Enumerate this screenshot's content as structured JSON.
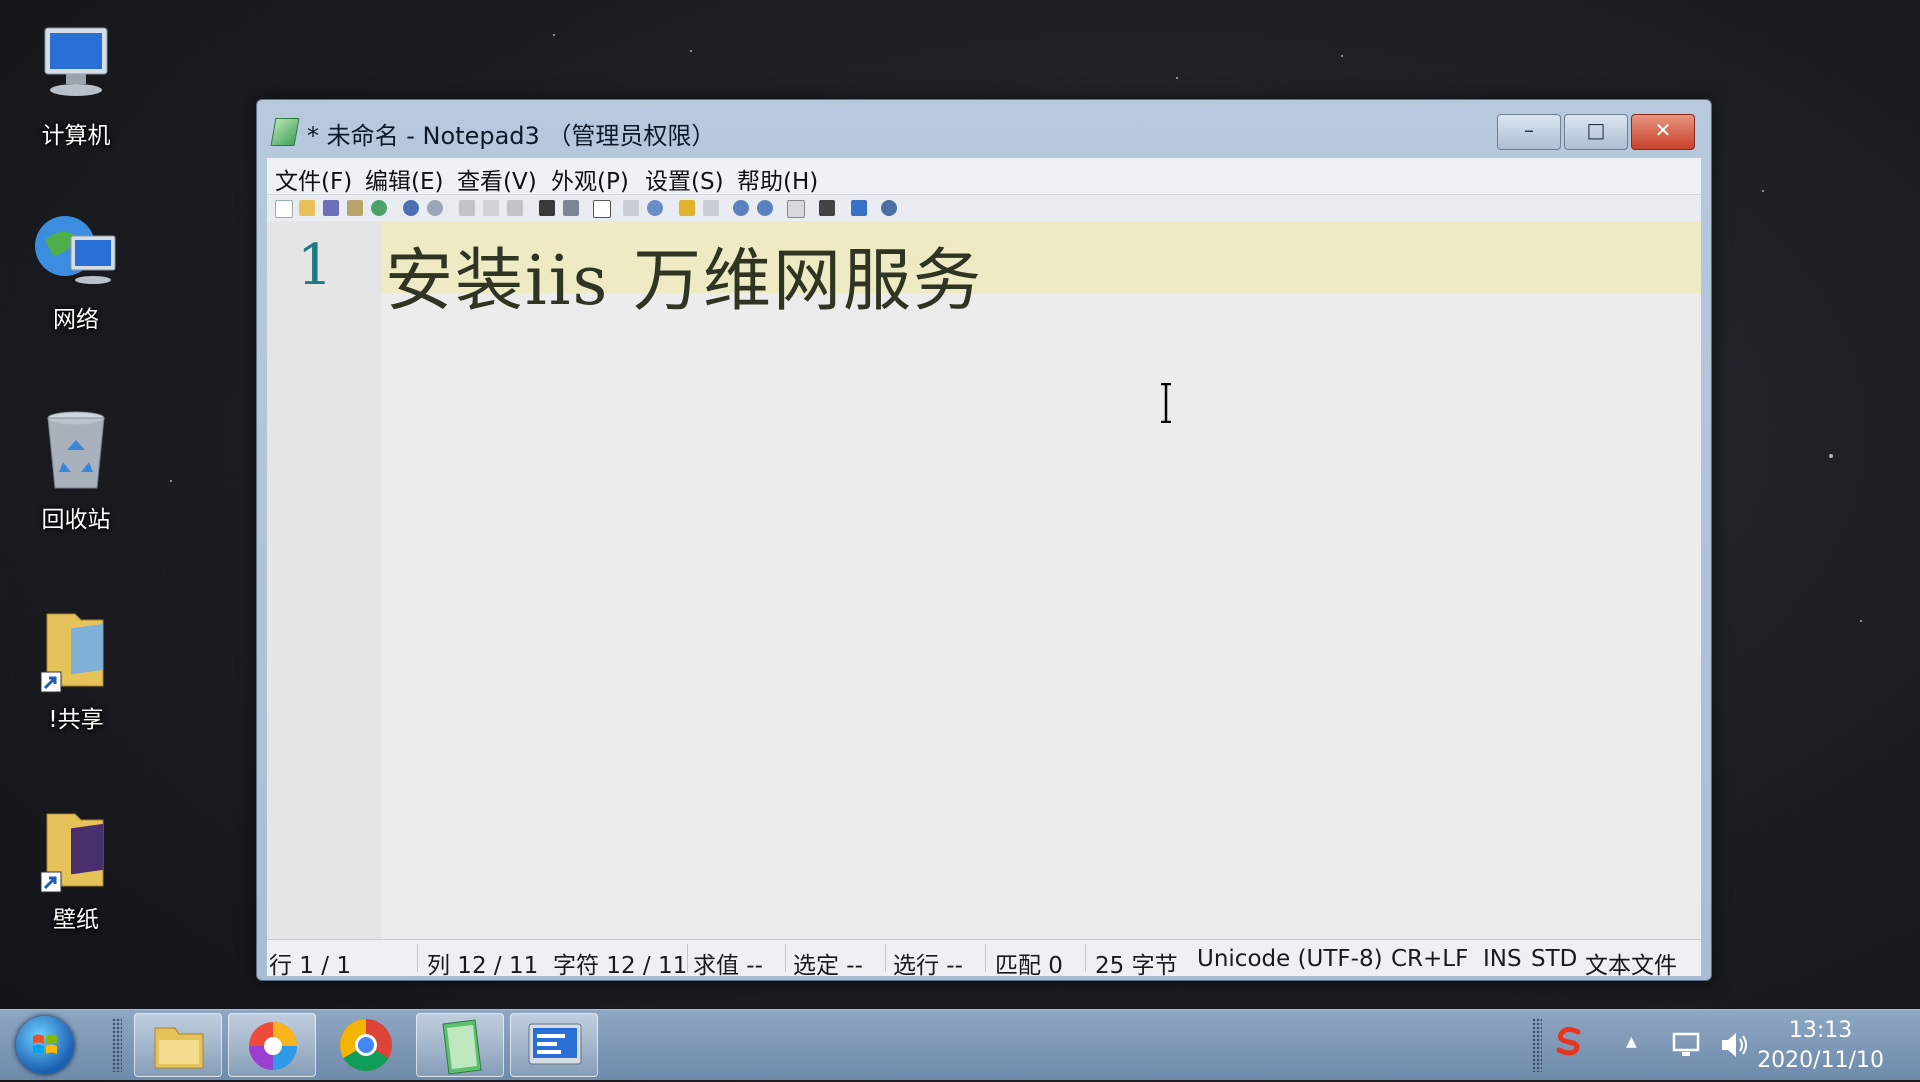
{
  "desktop": {
    "icons": [
      {
        "label": "计算机",
        "icon": "computer-icon"
      },
      {
        "label": "网络",
        "icon": "network-icon"
      },
      {
        "label": "回收站",
        "icon": "recycle-bin-icon"
      },
      {
        "label": "!共享",
        "icon": "folder-shortcut-icon"
      },
      {
        "label": "壁纸",
        "icon": "folder-shortcut-icon"
      }
    ]
  },
  "window": {
    "title": "* 未命名 - Notepad3 （管理员权限）",
    "controls": {
      "minimize": "–",
      "maximize": "□",
      "close": "✕"
    },
    "menu": [
      "文件(F)",
      "编辑(E)",
      "查看(V)",
      "外观(P)",
      "设置(S)",
      "帮助(H)"
    ],
    "editor": {
      "line_number": "1",
      "text": "安装iis 万维网服务",
      "current_line_color": "#eeeac4"
    },
    "status": {
      "line": "行  1 / 1",
      "col": "列  12 / 11",
      "chars": "字符  12 / 11",
      "eval": "求值  --",
      "selected": "选定  --",
      "sel_lines": "选行  --",
      "match": "匹配  0",
      "bytes": "25 字节",
      "encoding": "Unicode (UTF-8)",
      "eol": "CR+LF",
      "ins": "INS",
      "std": "STD",
      "lexer": "文本文件"
    }
  },
  "taskbar": {
    "apps": [
      "windows-explorer",
      "photos",
      "chrome",
      "notepad3",
      "control-panel"
    ],
    "clock_time": "13:13",
    "clock_date": "2020/11/10"
  }
}
